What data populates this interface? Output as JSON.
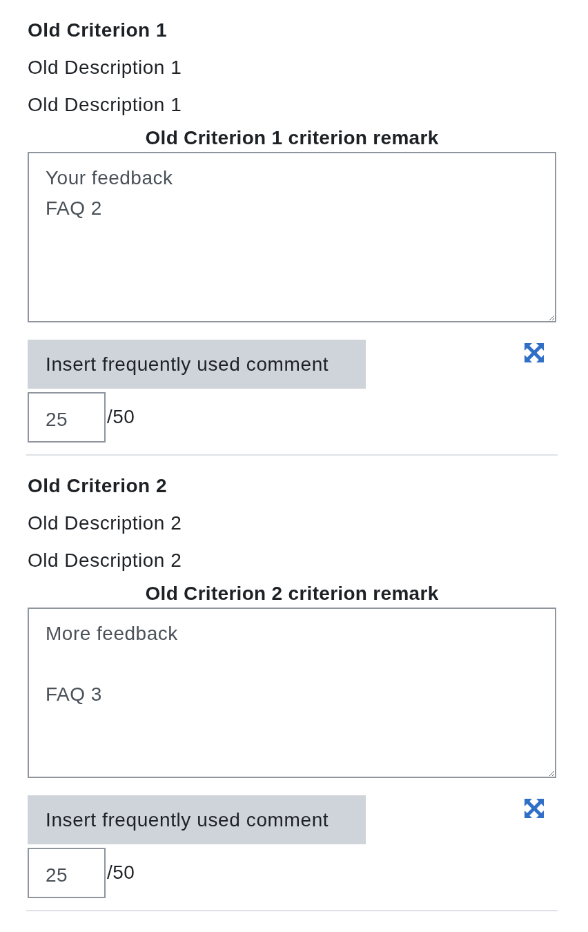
{
  "criteria": [
    {
      "title": "Old Criterion 1",
      "descriptions": [
        "Old Description 1",
        "Old Description 1"
      ],
      "remark_label": "Old Criterion 1 criterion remark",
      "remark": {
        "value": "Your feedback\nFAQ 2"
      },
      "comment_button": "Insert frequently used comment",
      "score": {
        "value": "25"
      },
      "max_score": "/50"
    },
    {
      "title": "Old Criterion 2",
      "descriptions": [
        "Old Description 2",
        "Old Description 2"
      ],
      "remark_label": "Old Criterion 2 criterion remark",
      "remark": {
        "value": "More feedback\n\nFAQ 3"
      },
      "comment_button": "Insert frequently used comment",
      "score": {
        "value": "25"
      },
      "max_score": "/50"
    }
  ]
}
